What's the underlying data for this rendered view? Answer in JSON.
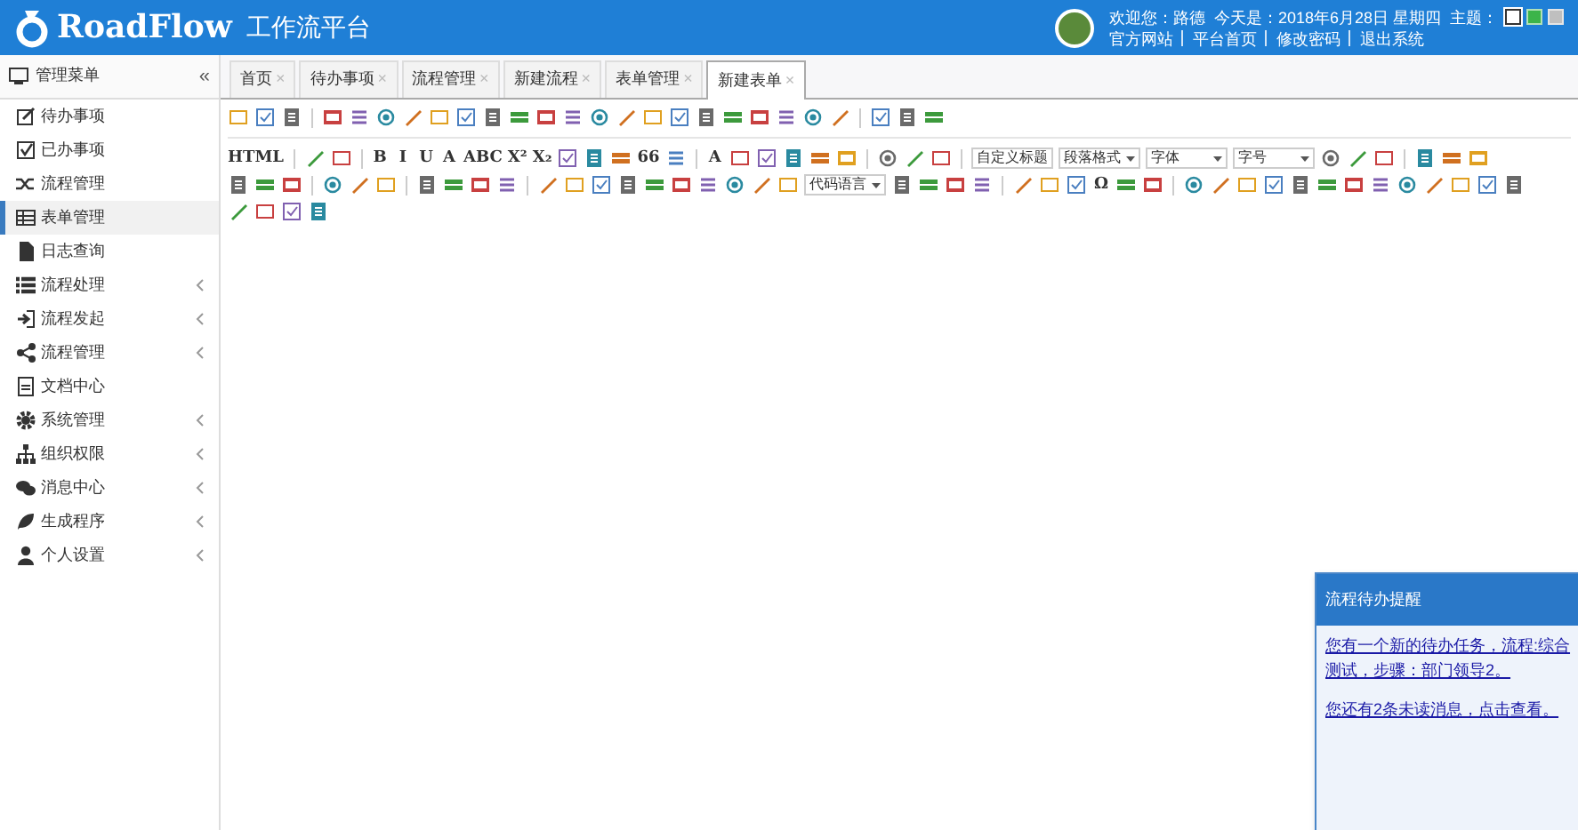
{
  "header": {
    "logo_text": "RoadFlow",
    "subtitle": "工作流平台",
    "welcome": "欢迎您：路德  今天是：2018年6月28日 星期四  主题：",
    "themes": [
      {
        "color": "#ffffff",
        "selected": true
      },
      {
        "color": "#3cb44a",
        "selected": false
      },
      {
        "color": "#bfbfbf",
        "selected": false
      }
    ],
    "links": [
      "官方网站",
      "平台首页",
      "修改密码",
      "退出系统"
    ]
  },
  "sidebar": {
    "title": "管理菜单",
    "collapse": "«",
    "items": [
      {
        "label": "待办事项",
        "has_children": false,
        "selected": false
      },
      {
        "label": "已办事项",
        "has_children": false,
        "selected": false
      },
      {
        "label": "流程管理",
        "has_children": false,
        "selected": false
      },
      {
        "label": "表单管理",
        "has_children": false,
        "selected": true
      },
      {
        "label": "日志查询",
        "has_children": false,
        "selected": false
      },
      {
        "label": "流程处理",
        "has_children": true,
        "selected": false
      },
      {
        "label": "流程发起",
        "has_children": true,
        "selected": false
      },
      {
        "label": "流程管理",
        "has_children": true,
        "selected": false
      },
      {
        "label": "文档中心",
        "has_children": false,
        "selected": false
      },
      {
        "label": "系统管理",
        "has_children": true,
        "selected": false
      },
      {
        "label": "组织权限",
        "has_children": true,
        "selected": false
      },
      {
        "label": "消息中心",
        "has_children": true,
        "selected": false
      },
      {
        "label": "生成程序",
        "has_children": true,
        "selected": false
      },
      {
        "label": "个人设置",
        "has_children": true,
        "selected": false
      }
    ]
  },
  "tabs": [
    {
      "label": "首页",
      "close": "×",
      "selected": false
    },
    {
      "label": "待办事项",
      "close": "×",
      "selected": false
    },
    {
      "label": "流程管理",
      "close": "×",
      "selected": false
    },
    {
      "label": "新建流程",
      "close": "×",
      "selected": false
    },
    {
      "label": "表单管理",
      "close": "×",
      "selected": false
    },
    {
      "label": "新建表单",
      "close": "×",
      "selected": true
    }
  ],
  "toolbar_rows": [
    [
      {
        "kind": "icon"
      },
      {
        "kind": "icon"
      },
      {
        "kind": "icon"
      },
      {
        "kind": "sep"
      },
      {
        "kind": "icon"
      },
      {
        "kind": "icon"
      },
      {
        "kind": "icon"
      },
      {
        "kind": "icon"
      },
      {
        "kind": "icon"
      },
      {
        "kind": "icon"
      },
      {
        "kind": "icon"
      },
      {
        "kind": "icon"
      },
      {
        "kind": "icon"
      },
      {
        "kind": "icon"
      },
      {
        "kind": "icon"
      },
      {
        "kind": "icon"
      },
      {
        "kind": "icon"
      },
      {
        "kind": "icon"
      },
      {
        "kind": "icon"
      },
      {
        "kind": "icon"
      },
      {
        "kind": "icon"
      },
      {
        "kind": "icon"
      },
      {
        "kind": "icon"
      },
      {
        "kind": "icon"
      },
      {
        "kind": "sep"
      },
      {
        "kind": "icon"
      },
      {
        "kind": "icon"
      },
      {
        "kind": "icon"
      }
    ],
    [
      {
        "kind": "glyph",
        "text": "HTML"
      },
      {
        "kind": "sep"
      },
      {
        "kind": "icon"
      },
      {
        "kind": "icon"
      },
      {
        "kind": "sep"
      },
      {
        "kind": "glyph",
        "text": "B"
      },
      {
        "kind": "glyph",
        "text": "I"
      },
      {
        "kind": "glyph",
        "text": "U"
      },
      {
        "kind": "glyph",
        "text": "A"
      },
      {
        "kind": "glyph",
        "text": "ABC"
      },
      {
        "kind": "glyph",
        "text": "X²"
      },
      {
        "kind": "glyph",
        "text": "X₂"
      },
      {
        "kind": "icon"
      },
      {
        "kind": "icon"
      },
      {
        "kind": "icon"
      },
      {
        "kind": "glyph",
        "text": "66"
      },
      {
        "kind": "icon"
      },
      {
        "kind": "sep"
      },
      {
        "kind": "glyph",
        "text": "A"
      },
      {
        "kind": "icon"
      },
      {
        "kind": "icon"
      },
      {
        "kind": "icon"
      },
      {
        "kind": "icon"
      },
      {
        "kind": "icon"
      },
      {
        "kind": "sep"
      },
      {
        "kind": "icon"
      },
      {
        "kind": "icon"
      },
      {
        "kind": "icon"
      },
      {
        "kind": "sep"
      },
      {
        "kind": "select",
        "text": "自定义标题"
      },
      {
        "kind": "select",
        "text": "段落格式"
      },
      {
        "kind": "select",
        "text": "字体"
      },
      {
        "kind": "select",
        "text": "字号"
      },
      {
        "kind": "icon"
      },
      {
        "kind": "icon"
      },
      {
        "kind": "icon"
      },
      {
        "kind": "sep"
      },
      {
        "kind": "icon"
      },
      {
        "kind": "icon"
      },
      {
        "kind": "icon"
      }
    ],
    [
      {
        "kind": "icon"
      },
      {
        "kind": "icon"
      },
      {
        "kind": "icon"
      },
      {
        "kind": "sep"
      },
      {
        "kind": "icon"
      },
      {
        "kind": "icon"
      },
      {
        "kind": "icon"
      },
      {
        "kind": "sep"
      },
      {
        "kind": "icon"
      },
      {
        "kind": "icon"
      },
      {
        "kind": "icon"
      },
      {
        "kind": "icon"
      },
      {
        "kind": "sep"
      },
      {
        "kind": "icon"
      },
      {
        "kind": "icon"
      },
      {
        "kind": "icon"
      },
      {
        "kind": "icon"
      },
      {
        "kind": "icon"
      },
      {
        "kind": "icon"
      },
      {
        "kind": "icon"
      },
      {
        "kind": "icon"
      },
      {
        "kind": "icon"
      },
      {
        "kind": "icon"
      },
      {
        "kind": "select",
        "text": "代码语言"
      },
      {
        "kind": "icon"
      },
      {
        "kind": "icon"
      },
      {
        "kind": "icon"
      },
      {
        "kind": "icon"
      },
      {
        "kind": "sep"
      },
      {
        "kind": "icon"
      },
      {
        "kind": "icon"
      },
      {
        "kind": "icon"
      },
      {
        "kind": "glyph",
        "text": "Ω"
      },
      {
        "kind": "icon"
      },
      {
        "kind": "icon"
      },
      {
        "kind": "sep"
      },
      {
        "kind": "icon"
      },
      {
        "kind": "icon"
      },
      {
        "kind": "icon"
      },
      {
        "kind": "icon"
      },
      {
        "kind": "icon"
      },
      {
        "kind": "icon"
      },
      {
        "kind": "icon"
      },
      {
        "kind": "icon"
      },
      {
        "kind": "icon"
      },
      {
        "kind": "icon"
      },
      {
        "kind": "icon"
      },
      {
        "kind": "icon"
      },
      {
        "kind": "icon"
      }
    ],
    [
      {
        "kind": "icon"
      },
      {
        "kind": "icon"
      },
      {
        "kind": "icon"
      },
      {
        "kind": "icon"
      }
    ]
  ],
  "popup": {
    "title": "流程待办提醒",
    "messages": [
      "您有一个新的待办任务，流程:综合测试，步骤：部门领导2。",
      "您还有2条未读消息，点击查看。"
    ]
  }
}
